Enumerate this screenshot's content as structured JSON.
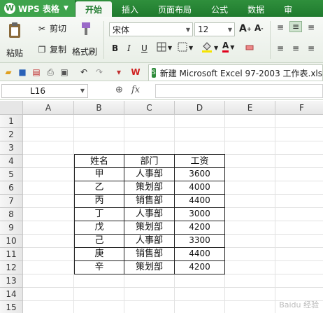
{
  "menubar": {
    "app_name": "WPS 表格",
    "logo": "W",
    "tabs": [
      "开始",
      "插入",
      "页面布局",
      "公式",
      "数据",
      "审"
    ]
  },
  "ribbon": {
    "paste": "粘贴",
    "cut": "剪切",
    "copy": "复制",
    "format_painter": "格式刷",
    "font_name": "宋体",
    "font_size": "12",
    "bold": "B",
    "italic": "I",
    "underline": "U"
  },
  "doc_tab": {
    "title": "新建 Microsoft Excel 97-2003 工作表.xls"
  },
  "formula_bar": {
    "cell_ref": "L16",
    "fx": "fx"
  },
  "grid": {
    "columns": [
      "A",
      "B",
      "C",
      "D",
      "E",
      "F"
    ],
    "rows": [
      "1",
      "2",
      "3",
      "4",
      "5",
      "6",
      "7",
      "8",
      "9",
      "10",
      "11",
      "12",
      "13",
      "14",
      "15"
    ]
  },
  "table": {
    "headers": [
      "姓名",
      "部门",
      "工资"
    ],
    "rows": [
      [
        "甲",
        "人事部",
        "3600"
      ],
      [
        "乙",
        "策划部",
        "4000"
      ],
      [
        "丙",
        "销售部",
        "4400"
      ],
      [
        "丁",
        "人事部",
        "3000"
      ],
      [
        "戊",
        "策划部",
        "4200"
      ],
      [
        "己",
        "人事部",
        "3300"
      ],
      [
        "庚",
        "销售部",
        "4400"
      ],
      [
        "辛",
        "策划部",
        "4200"
      ]
    ]
  },
  "watermark": "Baidu 经验"
}
